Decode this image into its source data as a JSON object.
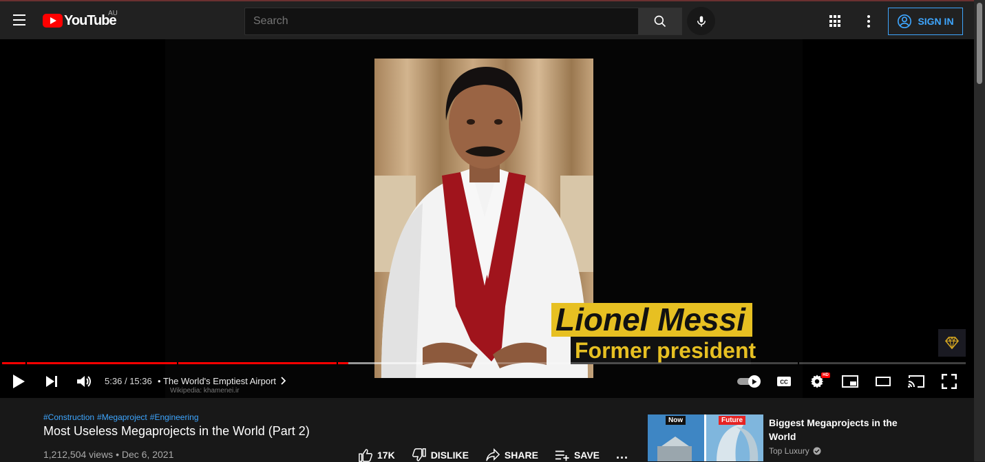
{
  "masthead": {
    "logo_text": "YouTube",
    "region": "AU",
    "search_placeholder": "Search",
    "signin_label": "SIGN IN"
  },
  "player": {
    "overlay_name": "Lionel Messi",
    "overlay_title": "Former president",
    "current_time": "5:36",
    "duration": "15:36",
    "time_separator": "/",
    "chapter_bullet": "•",
    "chapter_title": "The World's Emptiest Airport",
    "attribution": "Wikipedia: khamenei.ir",
    "progress_played_fraction": 0.359,
    "progress_loaded_fraction": 0.435,
    "hd_badge": "HD",
    "autoplay_on": true
  },
  "video": {
    "hashtags": [
      "#Construction",
      "#Megaproject",
      "#Engineering"
    ],
    "title": "Most Useless Megaprojects in the World (Part 2)",
    "views": "1,212,504 views",
    "date_separator": "•",
    "date": "Dec 6, 2021",
    "like_count": "17K",
    "dislike_label": "DISLIKE",
    "share_label": "SHARE",
    "save_label": "SAVE",
    "more_label": "..."
  },
  "related": {
    "thumb_left_tag": "Now",
    "thumb_right_tag": "Future",
    "title": "Biggest Megaprojects in the World",
    "channel": "Top Luxury"
  },
  "colors": {
    "accent_red": "#ff0000",
    "link_blue": "#3ea6ff",
    "overlay_yellow": "#e7c022",
    "background": "#181818",
    "masthead": "#212121"
  }
}
